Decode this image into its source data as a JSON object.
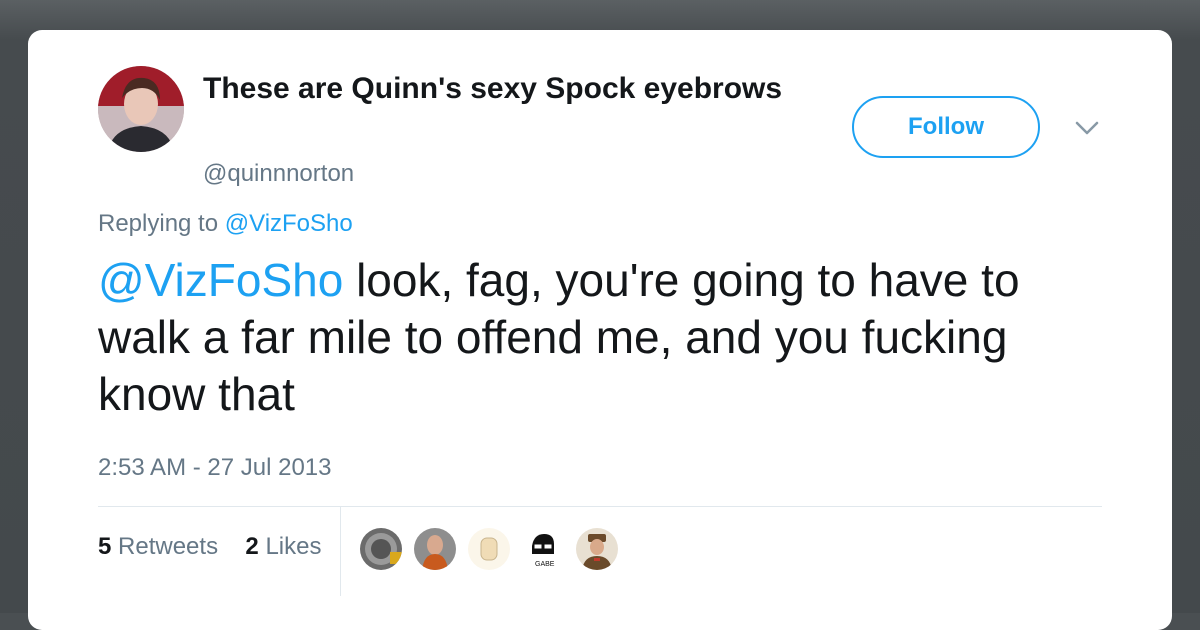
{
  "tweet": {
    "display_name": "These are Quinn's sexy Spock eyebrows",
    "handle": "@quinnnorton",
    "follow_label": "Follow",
    "replying_prefix": "Replying to",
    "replying_to": "@VizFoSho",
    "mention": "@VizFoSho",
    "body": " look, fag, you're going to have to walk a far mile to offend me, and you fucking know that",
    "timestamp": "2:53 AM - 27 Jul 2013",
    "retweets_count": "5",
    "retweets_label": "Retweets",
    "likes_count": "2",
    "likes_label": "Likes",
    "liker_avatars": [
      {
        "icon": "avatar-icon",
        "color": "#6b6b6b"
      },
      {
        "icon": "avatar-icon",
        "color": "#8a5a3a"
      },
      {
        "icon": "avatar-icon",
        "color": "#f3e6c8"
      },
      {
        "icon": "avatar-icon",
        "color": "#ffffff"
      },
      {
        "icon": "avatar-icon",
        "color": "#7a3b2b"
      }
    ]
  },
  "colors": {
    "link": "#1da1f2",
    "secondary_text": "#657786",
    "primary_text": "#14171a"
  }
}
